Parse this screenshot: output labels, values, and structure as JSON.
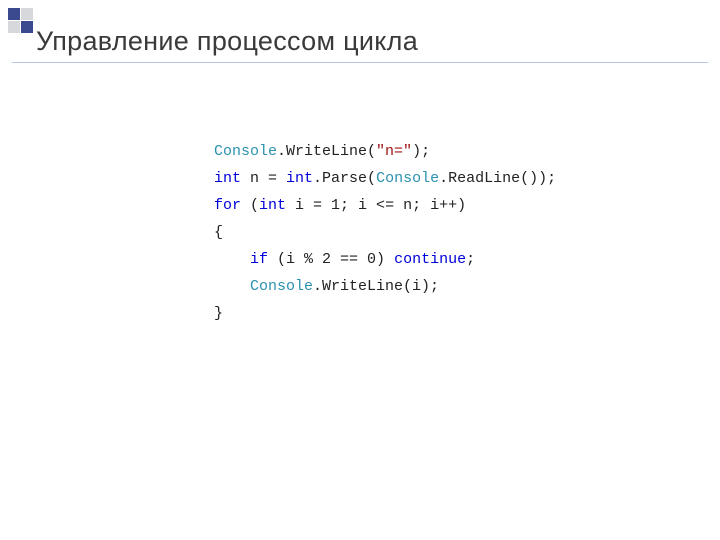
{
  "title": "Управление процессом цикла",
  "code": {
    "l1": {
      "a": "Console",
      "b": ".WriteLine(",
      "c": "\"n=\"",
      "d": ");"
    },
    "l2": {
      "a": "int",
      "b": " n = ",
      "c": "int",
      "d": ".Parse(",
      "e": "Console",
      "f": ".ReadLine());"
    },
    "l3": {
      "a": "for",
      "b": " (",
      "c": "int",
      "d": " i = 1; i <= n; i++)"
    },
    "l4": "{",
    "l5": {
      "a": "    ",
      "b": "if",
      "c": " (i % 2 == 0) ",
      "d": "continue",
      "e": ";"
    },
    "l6": {
      "a": "    ",
      "b": "Console",
      "c": ".WriteLine(i);"
    },
    "l7": "}"
  }
}
